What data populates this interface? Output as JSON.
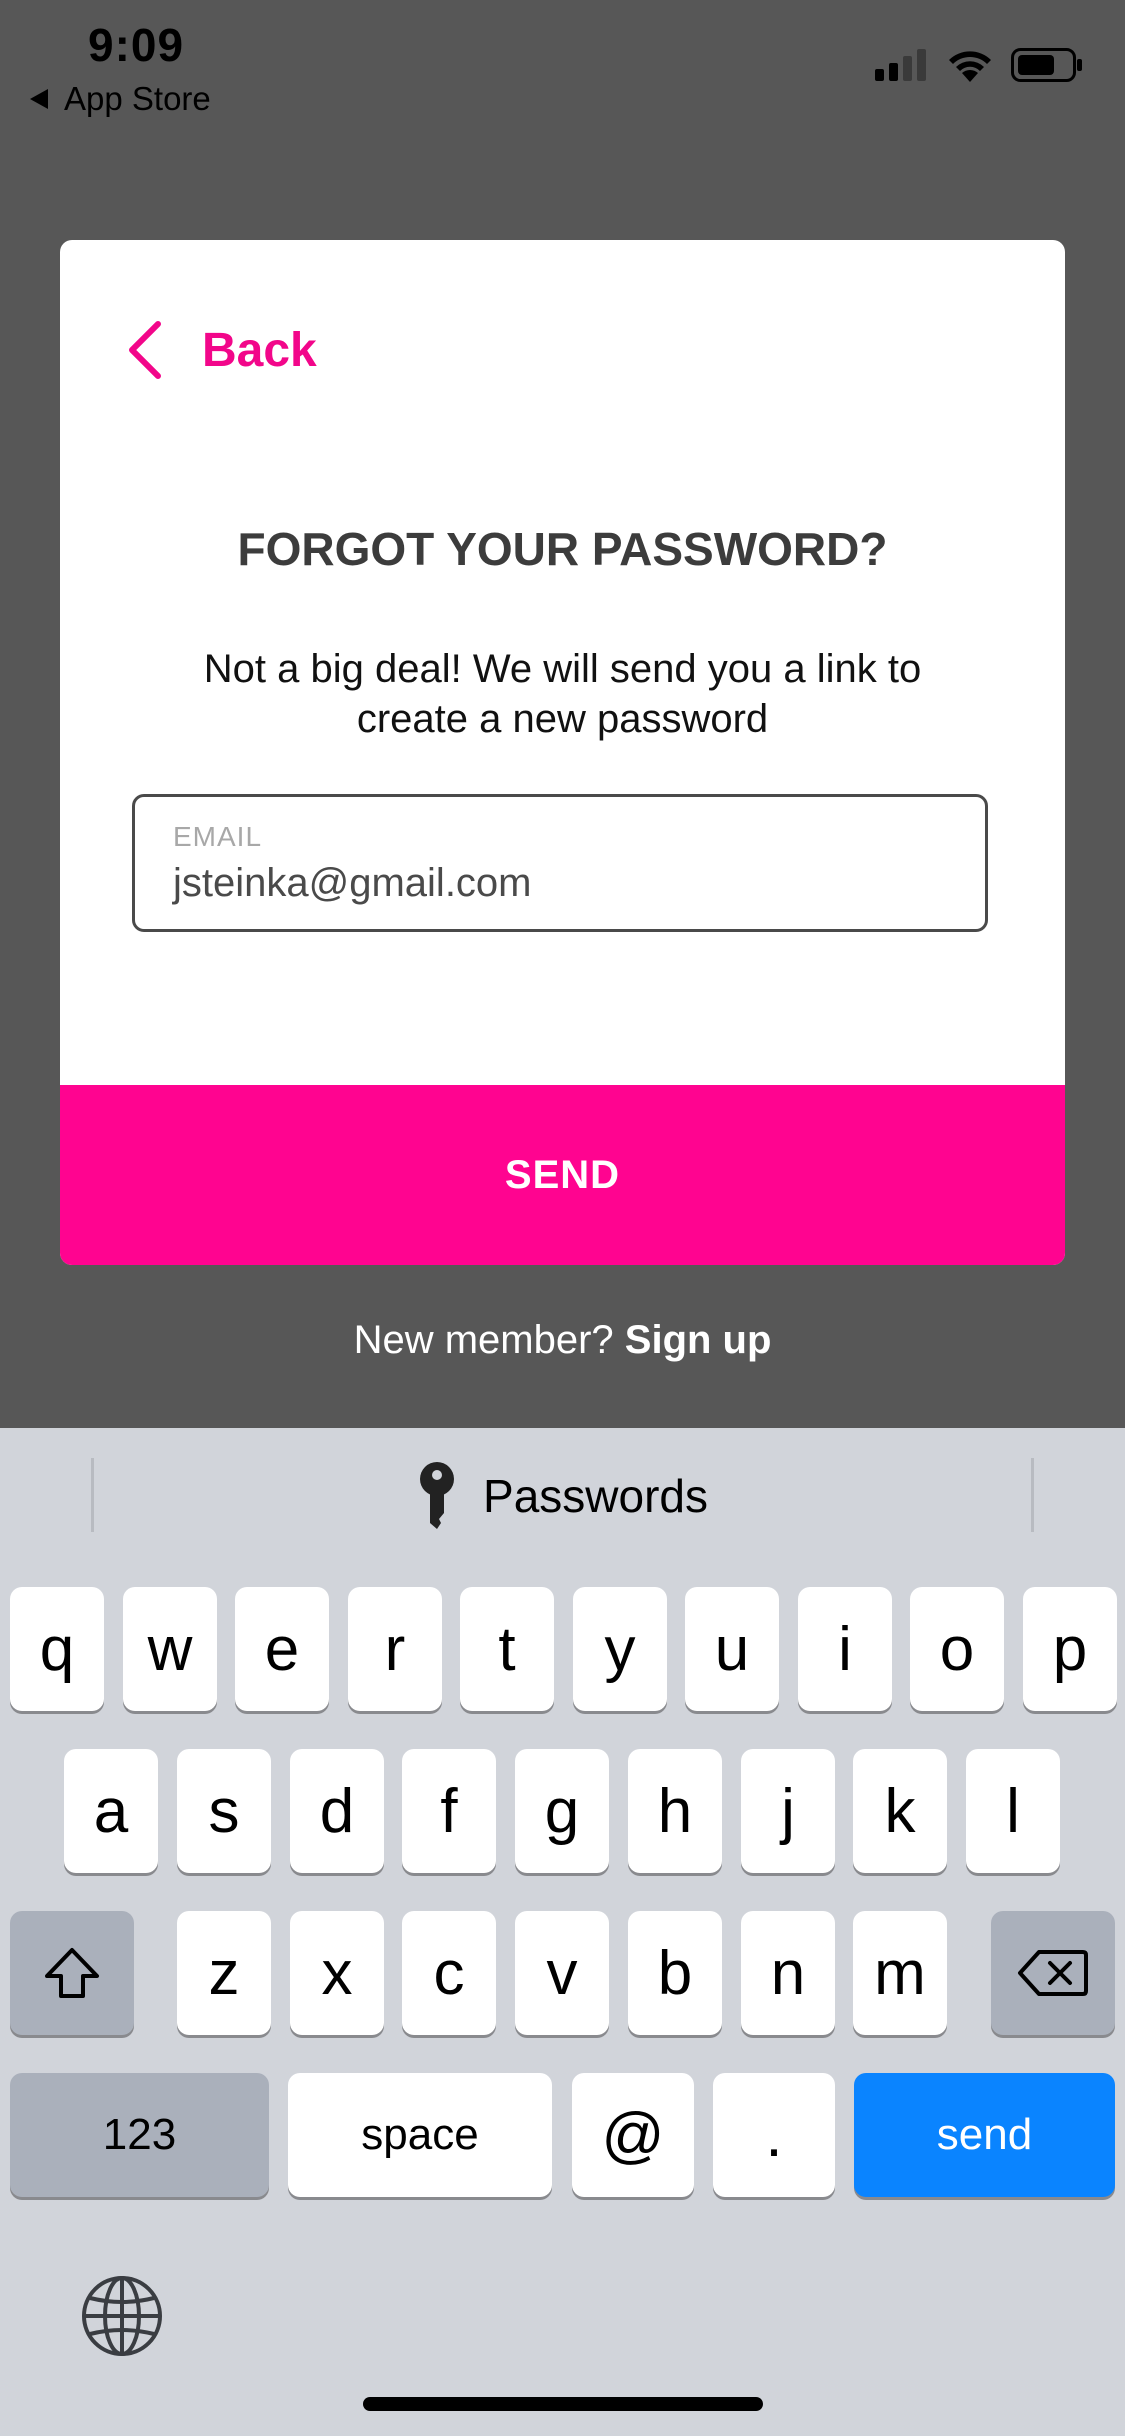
{
  "status_bar": {
    "time": "9:09",
    "back_app": "App Store",
    "icons": [
      "cellular-signal-icon",
      "wifi-icon",
      "battery-icon"
    ]
  },
  "modal": {
    "back_label": "Back",
    "title": "FORGOT YOUR PASSWORD?",
    "subtitle": "Not a big deal! We will send you a link to create a new password",
    "email_label": "EMAIL",
    "email_value": "jsteinka@gmail.com",
    "send_label": "SEND"
  },
  "footer": {
    "prompt": "New member?",
    "signup": "Sign up"
  },
  "keyboard": {
    "suggestion": "Passwords",
    "row1": [
      "q",
      "w",
      "e",
      "r",
      "t",
      "y",
      "u",
      "i",
      "o",
      "p"
    ],
    "row2": [
      "a",
      "s",
      "d",
      "f",
      "g",
      "h",
      "j",
      "k",
      "l"
    ],
    "row3": [
      "z",
      "x",
      "c",
      "v",
      "b",
      "n",
      "m"
    ],
    "numbers": "123",
    "space": "space",
    "at": "@",
    "dot": ".",
    "send": "send"
  },
  "colors": {
    "accent": "#ff0490",
    "back_text": "#f2068a",
    "send_key": "#0a84ff",
    "overlay": "#575757"
  }
}
